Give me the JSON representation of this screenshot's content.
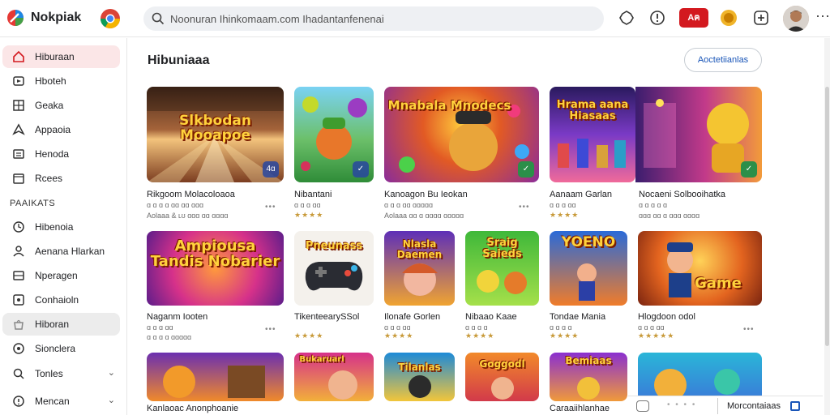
{
  "app": {
    "name": "Nokpiak"
  },
  "search": {
    "text": "Noonuran Ihinkomaam.com Ihadantanfenenai"
  },
  "header": {
    "live_label": "Aฅ"
  },
  "sidebar": {
    "items": [
      {
        "label": "Hiburaan",
        "icon": "home-icon"
      },
      {
        "label": "Hboteh",
        "icon": "shorts-icon"
      },
      {
        "label": "Geaka",
        "icon": "grid-icon"
      },
      {
        "label": "Appaoia",
        "icon": "send-icon"
      },
      {
        "label": "Henoda",
        "icon": "list-icon"
      },
      {
        "label": "Rcees",
        "icon": "calendar-icon"
      }
    ],
    "section_label": "PAAIKATS",
    "section_items": [
      {
        "label": "Hibenoia",
        "icon": "clock-icon"
      },
      {
        "label": "Aenana Hlarkan",
        "icon": "person-icon"
      },
      {
        "label": "Nperagen",
        "icon": "library-icon"
      },
      {
        "label": "Conhaioln",
        "icon": "settings-icon"
      },
      {
        "label": "Hiboran",
        "icon": "bag-icon"
      },
      {
        "label": "Sionclera",
        "icon": "compass-icon"
      },
      {
        "label": "Tonles",
        "icon": "search-icon"
      },
      {
        "label": "Mencan",
        "icon": "help-icon"
      }
    ]
  },
  "main": {
    "title": "Hibuniaaa",
    "action_label": "Aoctetiianlas",
    "row1": [
      {
        "title": "Rikgoom  Molacoloaoa",
        "meta1": "ɑ ɑ ɑ ɑ ɑɑ ɑɑ ɑɑɑ",
        "meta2": "Aolaaa & ʟʊ ɑɑɑ ɑɑ ɑɑɑɑ",
        "art": "Slkbodan Mooapoe",
        "badge": "4ɑ"
      },
      {
        "title": "Nibantani",
        "meta1": "ɑ ɑ ɑ ɑɑ",
        "stars": "★★★★",
        "badge": "✓"
      },
      {
        "title": "Kanoagon Bu Ieokan",
        "meta1": "ɑ ɑ ɑ ɑɑ ɑɑɑɑɑ",
        "meta2": "Aolaaa ɑɑ ɑ ɑɑɑɑ ɑɑɑɑɑ",
        "art": "Mnabala Mnodecs",
        "badge": "✓"
      },
      {
        "title": "Aanaam Garlan",
        "meta1": "ɑ ɑ ɑ ɑɑ",
        "stars": "★★★★",
        "art": "Hrama aana Hiasaas"
      },
      {
        "title": "Nocaeni Solbooihatka",
        "meta1": "ɑ ɑ ɑ ɑ ɑ",
        "meta2": "ɑɑɑ ɑɑ ɑ ɑɑɑ ɑɑɑɑ",
        "badge": "✓"
      }
    ],
    "row2": [
      {
        "title": "Naganm Iooten",
        "meta1": "ɑ ɑ ɑ ɑɑ",
        "meta2": "ɑ ɑ ɑ ɑ ɑɑɑɑɑ",
        "art": "Ampiousa Tandis Nobarier"
      },
      {
        "title": "TikenteearySSol",
        "stars": "★★★★",
        "art": "Pneunass"
      },
      {
        "title": "Ilonafe Gorlen",
        "meta1": "ɑ ɑ ɑ ɑɑ",
        "stars": "★★★★",
        "art": "Nlasla Daemen"
      },
      {
        "title": "Nibaao Kaae",
        "meta1": "ɑ ɑ ɑ ɑ",
        "stars": "★★★★",
        "art": "Sraig Saieds"
      },
      {
        "title": "Tondae Mania",
        "meta1": "ɑ ɑ ɑ ɑ",
        "stars": "★★★★",
        "art": "YOENO"
      },
      {
        "title": "Hlogdoon odol",
        "meta1": "ɑ ɑ ɑ ɑɑ",
        "stars": "★★★★★",
        "art": "Game"
      }
    ],
    "row3": [
      {
        "title": "Kanlaoac Anonphoanie"
      },
      {
        "title": "",
        "art": "Bukaruarl"
      },
      {
        "title": "",
        "art": "Tilanlas"
      },
      {
        "title": "",
        "art": "Goggodl"
      },
      {
        "title": "Caraaiihlanhae",
        "art": "Bemiaas"
      },
      {
        "title": ""
      }
    ]
  },
  "bottom": {
    "label": "Morcontaiaas"
  },
  "colors": {
    "accent": "#d3191f",
    "link": "#1a56b8",
    "active_bg": "#fbe6e7"
  }
}
